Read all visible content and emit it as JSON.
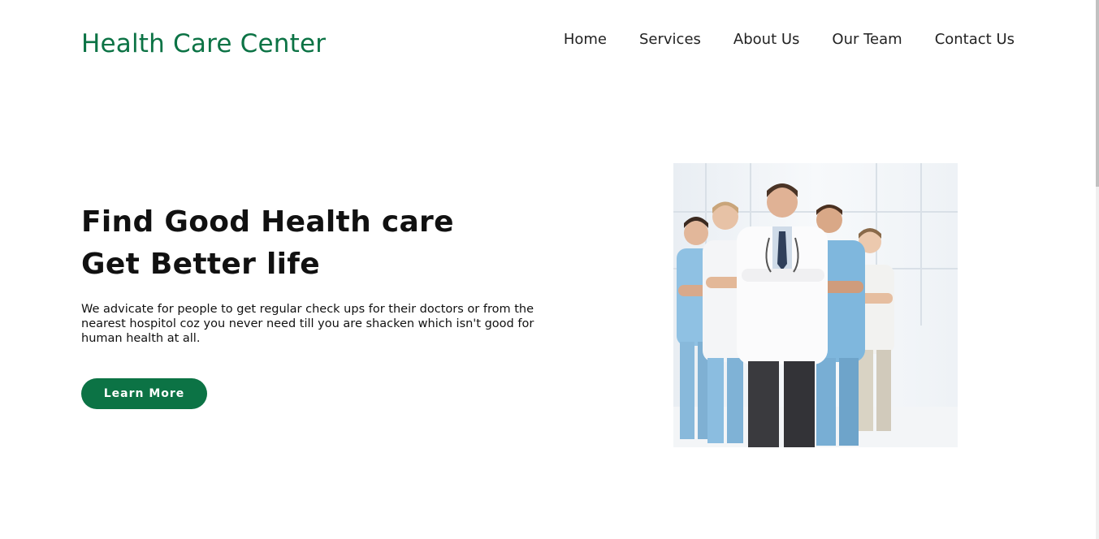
{
  "header": {
    "brand": "Health Care Center",
    "nav": [
      {
        "label": "Home"
      },
      {
        "label": "Services"
      },
      {
        "label": "About Us"
      },
      {
        "label": "Our Team"
      },
      {
        "label": "Contact Us"
      }
    ]
  },
  "hero": {
    "title_line1": "Find Good Health care",
    "title_line2": "Get Better life",
    "description": "We advicate for people to get regular check ups for their doctors or from the nearest hospitol coz you never need till you are shacken which isn't good for human health at all.",
    "button_label": "Learn More",
    "image": {
      "subject": "group of doctors and nurses with arms crossed"
    }
  },
  "colors": {
    "brand": "#0c7345",
    "text": "#111111",
    "background": "#ffffff"
  }
}
